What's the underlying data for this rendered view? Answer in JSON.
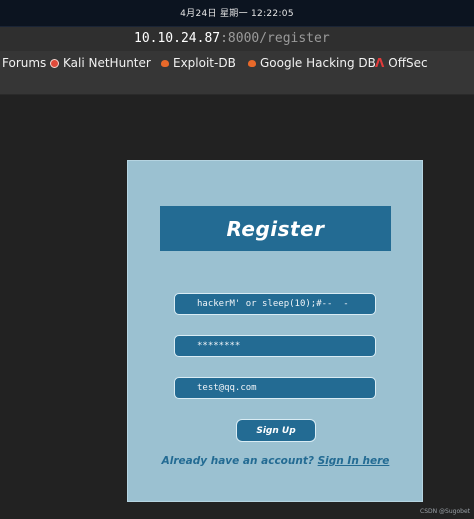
{
  "system": {
    "clock": "4月24日 星期一  12:22:05"
  },
  "browser": {
    "url_host": "10.10.24.87",
    "url_rest": ":8000/register",
    "bookmarks": [
      {
        "label": "Forums",
        "icon": "none"
      },
      {
        "label": "Kali NetHunter",
        "icon": "kali-dragon-icon"
      },
      {
        "label": "Exploit-DB",
        "icon": "exploitdb-icon"
      },
      {
        "label": "Google Hacking DB",
        "icon": "exploitdb-icon"
      },
      {
        "label": "OffSec",
        "icon": "offsec-icon",
        "icon_glyph": "Ʌ"
      }
    ]
  },
  "form": {
    "title": "Register",
    "username_value": "hackerM' or sleep(10);#--  -",
    "password_value": "********",
    "email_value": "test@qq.com",
    "submit_label": "Sign Up",
    "already_text": "Already have an account?",
    "signin_link": "Sign In here"
  },
  "watermark": "CSDN @Sugobet",
  "colors": {
    "page_bg": "#222222",
    "panel_bg": "#9bc1d1",
    "accent": "#236b93"
  }
}
